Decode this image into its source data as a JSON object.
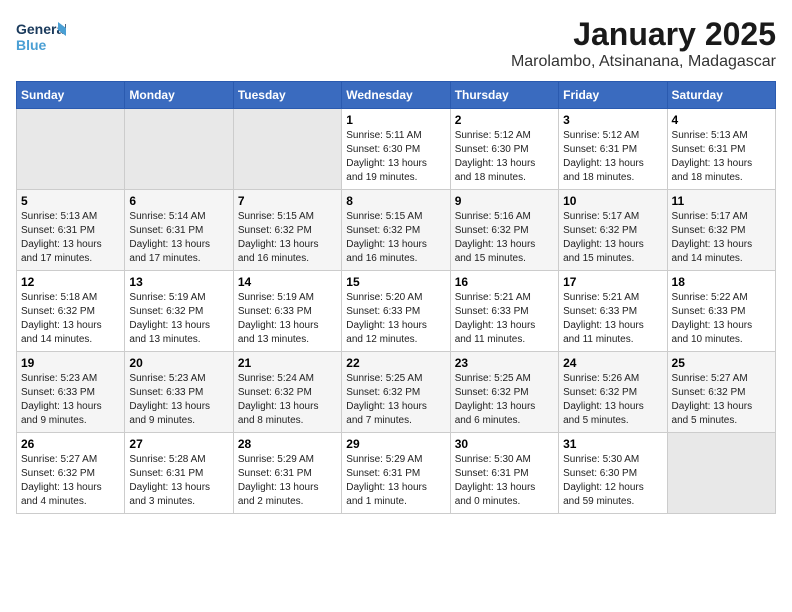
{
  "header": {
    "logo_line1": "General",
    "logo_line2": "Blue",
    "title": "January 2025",
    "subtitle": "Marolambo, Atsinanana, Madagascar"
  },
  "weekdays": [
    "Sunday",
    "Monday",
    "Tuesday",
    "Wednesday",
    "Thursday",
    "Friday",
    "Saturday"
  ],
  "weeks": [
    [
      {
        "day": "",
        "info": ""
      },
      {
        "day": "",
        "info": ""
      },
      {
        "day": "",
        "info": ""
      },
      {
        "day": "1",
        "info": "Sunrise: 5:11 AM\nSunset: 6:30 PM\nDaylight: 13 hours\nand 19 minutes."
      },
      {
        "day": "2",
        "info": "Sunrise: 5:12 AM\nSunset: 6:30 PM\nDaylight: 13 hours\nand 18 minutes."
      },
      {
        "day": "3",
        "info": "Sunrise: 5:12 AM\nSunset: 6:31 PM\nDaylight: 13 hours\nand 18 minutes."
      },
      {
        "day": "4",
        "info": "Sunrise: 5:13 AM\nSunset: 6:31 PM\nDaylight: 13 hours\nand 18 minutes."
      }
    ],
    [
      {
        "day": "5",
        "info": "Sunrise: 5:13 AM\nSunset: 6:31 PM\nDaylight: 13 hours\nand 17 minutes."
      },
      {
        "day": "6",
        "info": "Sunrise: 5:14 AM\nSunset: 6:31 PM\nDaylight: 13 hours\nand 17 minutes."
      },
      {
        "day": "7",
        "info": "Sunrise: 5:15 AM\nSunset: 6:32 PM\nDaylight: 13 hours\nand 16 minutes."
      },
      {
        "day": "8",
        "info": "Sunrise: 5:15 AM\nSunset: 6:32 PM\nDaylight: 13 hours\nand 16 minutes."
      },
      {
        "day": "9",
        "info": "Sunrise: 5:16 AM\nSunset: 6:32 PM\nDaylight: 13 hours\nand 15 minutes."
      },
      {
        "day": "10",
        "info": "Sunrise: 5:17 AM\nSunset: 6:32 PM\nDaylight: 13 hours\nand 15 minutes."
      },
      {
        "day": "11",
        "info": "Sunrise: 5:17 AM\nSunset: 6:32 PM\nDaylight: 13 hours\nand 14 minutes."
      }
    ],
    [
      {
        "day": "12",
        "info": "Sunrise: 5:18 AM\nSunset: 6:32 PM\nDaylight: 13 hours\nand 14 minutes."
      },
      {
        "day": "13",
        "info": "Sunrise: 5:19 AM\nSunset: 6:32 PM\nDaylight: 13 hours\nand 13 minutes."
      },
      {
        "day": "14",
        "info": "Sunrise: 5:19 AM\nSunset: 6:33 PM\nDaylight: 13 hours\nand 13 minutes."
      },
      {
        "day": "15",
        "info": "Sunrise: 5:20 AM\nSunset: 6:33 PM\nDaylight: 13 hours\nand 12 minutes."
      },
      {
        "day": "16",
        "info": "Sunrise: 5:21 AM\nSunset: 6:33 PM\nDaylight: 13 hours\nand 11 minutes."
      },
      {
        "day": "17",
        "info": "Sunrise: 5:21 AM\nSunset: 6:33 PM\nDaylight: 13 hours\nand 11 minutes."
      },
      {
        "day": "18",
        "info": "Sunrise: 5:22 AM\nSunset: 6:33 PM\nDaylight: 13 hours\nand 10 minutes."
      }
    ],
    [
      {
        "day": "19",
        "info": "Sunrise: 5:23 AM\nSunset: 6:33 PM\nDaylight: 13 hours\nand 9 minutes."
      },
      {
        "day": "20",
        "info": "Sunrise: 5:23 AM\nSunset: 6:33 PM\nDaylight: 13 hours\nand 9 minutes."
      },
      {
        "day": "21",
        "info": "Sunrise: 5:24 AM\nSunset: 6:32 PM\nDaylight: 13 hours\nand 8 minutes."
      },
      {
        "day": "22",
        "info": "Sunrise: 5:25 AM\nSunset: 6:32 PM\nDaylight: 13 hours\nand 7 minutes."
      },
      {
        "day": "23",
        "info": "Sunrise: 5:25 AM\nSunset: 6:32 PM\nDaylight: 13 hours\nand 6 minutes."
      },
      {
        "day": "24",
        "info": "Sunrise: 5:26 AM\nSunset: 6:32 PM\nDaylight: 13 hours\nand 5 minutes."
      },
      {
        "day": "25",
        "info": "Sunrise: 5:27 AM\nSunset: 6:32 PM\nDaylight: 13 hours\nand 5 minutes."
      }
    ],
    [
      {
        "day": "26",
        "info": "Sunrise: 5:27 AM\nSunset: 6:32 PM\nDaylight: 13 hours\nand 4 minutes."
      },
      {
        "day": "27",
        "info": "Sunrise: 5:28 AM\nSunset: 6:31 PM\nDaylight: 13 hours\nand 3 minutes."
      },
      {
        "day": "28",
        "info": "Sunrise: 5:29 AM\nSunset: 6:31 PM\nDaylight: 13 hours\nand 2 minutes."
      },
      {
        "day": "29",
        "info": "Sunrise: 5:29 AM\nSunset: 6:31 PM\nDaylight: 13 hours\nand 1 minute."
      },
      {
        "day": "30",
        "info": "Sunrise: 5:30 AM\nSunset: 6:31 PM\nDaylight: 13 hours\nand 0 minutes."
      },
      {
        "day": "31",
        "info": "Sunrise: 5:30 AM\nSunset: 6:30 PM\nDaylight: 12 hours\nand 59 minutes."
      },
      {
        "day": "",
        "info": ""
      }
    ]
  ]
}
